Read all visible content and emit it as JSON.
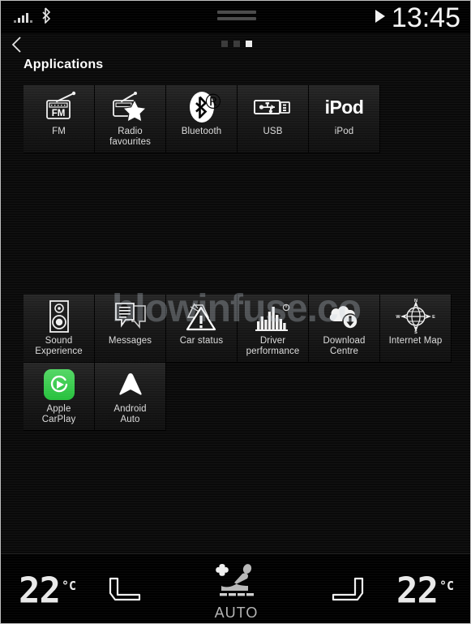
{
  "status_bar": {
    "signal_icon": "signal-bars-icon",
    "bluetooth_icon": "bluetooth-icon",
    "bluetooth_glyph": "␢",
    "play_icon": "play-icon",
    "clock": "13:45",
    "drag_handle": "drag-handle"
  },
  "nav": {
    "back_icon": "back-chevron-icon",
    "page_dots": [
      false,
      false,
      true
    ]
  },
  "header": {
    "title": "Applications"
  },
  "watermark": {
    "text": "blowinfuse.co"
  },
  "apps": {
    "group1": [
      {
        "label": "FM",
        "icon": "fm-radio-icon",
        "label_lines": [
          "FM"
        ]
      },
      {
        "label": "Radio favourites",
        "icon": "radio-favourites-icon",
        "label_lines": [
          "Radio",
          "favourites"
        ]
      },
      {
        "label": "Bluetooth",
        "icon": "bluetooth-icon",
        "label_lines": [
          "Bluetooth"
        ]
      },
      {
        "label": "USB",
        "icon": "usb-icon",
        "label_lines": [
          "USB"
        ]
      },
      {
        "label": "iPod",
        "icon": "ipod-icon",
        "label_lines": [
          "iPod"
        ],
        "icon_text": "iPod"
      }
    ],
    "group2": [
      {
        "label": "Sound Experience",
        "icon": "speaker-icon",
        "label_lines": [
          "Sound",
          "Experience"
        ]
      },
      {
        "label": "Messages",
        "icon": "message-icon",
        "label_lines": [
          "Messages"
        ]
      },
      {
        "label": "Car status",
        "icon": "warning-triangle-icon",
        "label_lines": [
          "Car status"
        ]
      },
      {
        "label": "Driver performance",
        "icon": "bar-chart-icon",
        "label_lines": [
          "Driver",
          "performance"
        ]
      },
      {
        "label": "Download Centre",
        "icon": "cloud-download-icon",
        "label_lines": [
          "Download",
          "Centre"
        ]
      },
      {
        "label": "Internet Map",
        "icon": "compass-globe-icon",
        "label_lines": [
          "Internet Map"
        ]
      }
    ],
    "group3": [
      {
        "label": "Apple CarPlay",
        "icon": "apple-carplay-icon",
        "label_lines": [
          "Apple",
          "CarPlay"
        ],
        "color": "#35c94a"
      },
      {
        "label": "Android Auto",
        "icon": "android-auto-icon",
        "label_lines": [
          "Android",
          "Auto"
        ]
      }
    ]
  },
  "climate": {
    "left_temperature": "22",
    "left_unit": "°C",
    "right_temperature": "22",
    "right_unit": "°C",
    "left_seat_icon": "seat-heat-left-icon",
    "right_seat_icon": "seat-heat-right-icon",
    "auto_label": "AUTO",
    "auto_icon": "climate-auto-seat-fan-icon"
  },
  "colors": {
    "background": "#0a0a0a",
    "tile_top": "#242424",
    "tile_bottom": "#0d0d0d",
    "text": "#dcdcdc",
    "accent_green": "#35c94a"
  }
}
